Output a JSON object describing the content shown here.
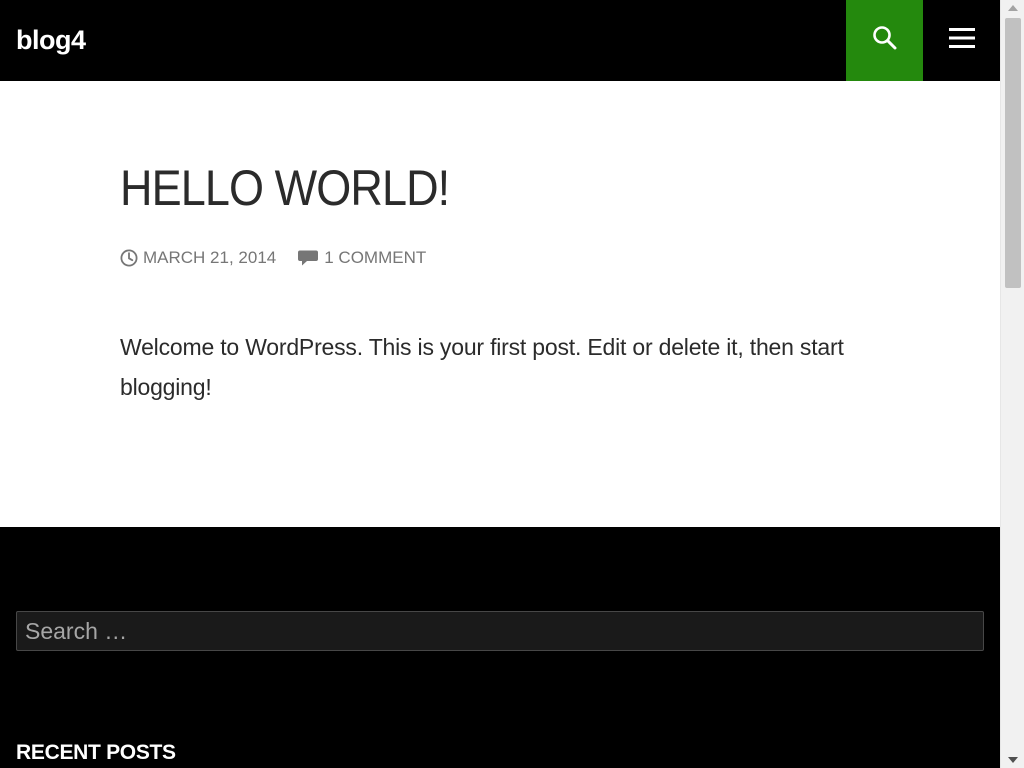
{
  "header": {
    "site_title": "blog4",
    "search_toggle_icon": "search-icon",
    "menu_toggle_icon": "hamburger-menu-icon",
    "accent_color": "#24890d"
  },
  "post": {
    "title": "HELLO WORLD!",
    "date": "MARCH 21, 2014",
    "comments": "1 COMMENT",
    "date_icon": "clock-icon",
    "comments_icon": "comment-bubble-icon",
    "body": "Welcome to WordPress. This is your first post. Edit or delete it, then start blogging!"
  },
  "footer": {
    "search_placeholder": "Search …",
    "recent_posts_title": "RECENT POSTS"
  }
}
